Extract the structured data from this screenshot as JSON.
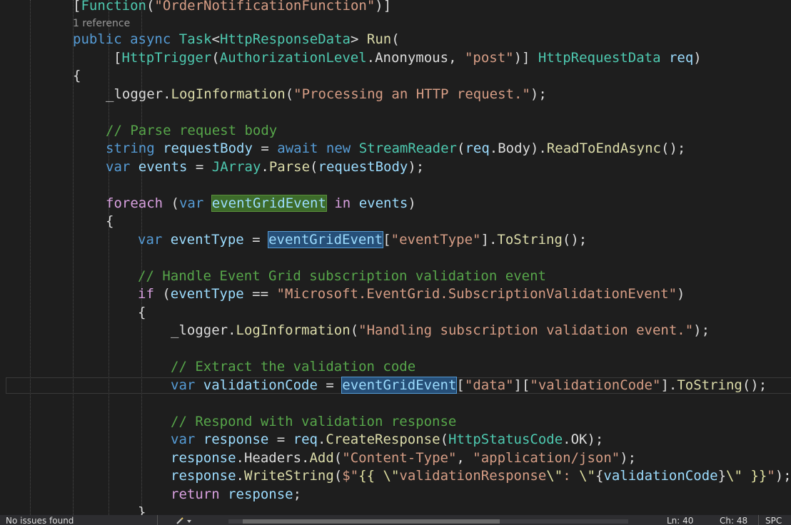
{
  "editor": {
    "codelens": "1 reference",
    "lines": [
      {
        "segments": [
          {
            "c": "fld",
            "t": "["
          },
          {
            "c": "ty",
            "t": "Function"
          },
          {
            "c": "fld",
            "t": "("
          },
          {
            "c": "str",
            "t": "\"OrderNotificationFunction\""
          },
          {
            "c": "fld",
            "t": ")]"
          }
        ]
      },
      {
        "segments": [
          {
            "c": "kw",
            "t": "public"
          },
          {
            "c": "fld",
            "t": " "
          },
          {
            "c": "kw",
            "t": "async"
          },
          {
            "c": "fld",
            "t": " "
          },
          {
            "c": "ty",
            "t": "Task"
          },
          {
            "c": "fld",
            "t": "<"
          },
          {
            "c": "ty",
            "t": "HttpResponseData"
          },
          {
            "c": "fld",
            "t": "> "
          },
          {
            "c": "mth",
            "t": "Run"
          },
          {
            "c": "fld",
            "t": "("
          }
        ]
      },
      {
        "segments": [
          {
            "c": "fld",
            "t": "["
          },
          {
            "c": "ty",
            "t": "HttpTrigger"
          },
          {
            "c": "fld",
            "t": "("
          },
          {
            "c": "ty",
            "t": "AuthorizationLevel"
          },
          {
            "c": "fld",
            "t": "."
          },
          {
            "c": "fld",
            "t": "Anonymous"
          },
          {
            "c": "fld",
            "t": ", "
          },
          {
            "c": "str",
            "t": "\"post\""
          },
          {
            "c": "fld",
            "t": ")] "
          },
          {
            "c": "ty",
            "t": "HttpRequestData"
          },
          {
            "c": "fld",
            "t": " "
          },
          {
            "c": "var",
            "t": "req"
          },
          {
            "c": "fld",
            "t": ")"
          }
        ]
      },
      {
        "segments": [
          {
            "c": "fld",
            "t": "{"
          }
        ]
      },
      {
        "segments": [
          {
            "c": "fld",
            "t": "_logger"
          },
          {
            "c": "fld",
            "t": "."
          },
          {
            "c": "mth",
            "t": "LogInformation"
          },
          {
            "c": "fld",
            "t": "("
          },
          {
            "c": "str",
            "t": "\"Processing an HTTP request.\""
          },
          {
            "c": "fld",
            "t": ");"
          }
        ]
      },
      {
        "segments": [
          {
            "c": "cm",
            "t": "// Parse request body"
          }
        ]
      },
      {
        "segments": [
          {
            "c": "kw",
            "t": "string"
          },
          {
            "c": "fld",
            "t": " "
          },
          {
            "c": "var",
            "t": "requestBody"
          },
          {
            "c": "fld",
            "t": " = "
          },
          {
            "c": "kw",
            "t": "await"
          },
          {
            "c": "fld",
            "t": " "
          },
          {
            "c": "kw",
            "t": "new"
          },
          {
            "c": "fld",
            "t": " "
          },
          {
            "c": "ty",
            "t": "StreamReader"
          },
          {
            "c": "fld",
            "t": "("
          },
          {
            "c": "var",
            "t": "req"
          },
          {
            "c": "fld",
            "t": ".Body)."
          },
          {
            "c": "mth",
            "t": "ReadToEndAsync"
          },
          {
            "c": "fld",
            "t": "();"
          }
        ]
      },
      {
        "segments": [
          {
            "c": "kw",
            "t": "var"
          },
          {
            "c": "fld",
            "t": " "
          },
          {
            "c": "var",
            "t": "events"
          },
          {
            "c": "fld",
            "t": " = "
          },
          {
            "c": "ty",
            "t": "JArray"
          },
          {
            "c": "fld",
            "t": "."
          },
          {
            "c": "mth",
            "t": "Parse"
          },
          {
            "c": "fld",
            "t": "("
          },
          {
            "c": "var",
            "t": "requestBody"
          },
          {
            "c": "fld",
            "t": ");"
          }
        ]
      },
      {
        "segments": [
          {
            "c": "ctl",
            "t": "foreach"
          },
          {
            "c": "fld",
            "t": " ("
          },
          {
            "c": "kw",
            "t": "var"
          },
          {
            "c": "fld",
            "t": " "
          },
          {
            "c": "hl-def",
            "t": "eventGridEvent"
          },
          {
            "c": "fld",
            "t": " "
          },
          {
            "c": "ctl",
            "t": "in"
          },
          {
            "c": "fld",
            "t": " "
          },
          {
            "c": "var",
            "t": "events"
          },
          {
            "c": "fld",
            "t": ")"
          }
        ]
      },
      {
        "segments": [
          {
            "c": "fld",
            "t": "{"
          }
        ]
      },
      {
        "segments": [
          {
            "c": "kw",
            "t": "var"
          },
          {
            "c": "fld",
            "t": " "
          },
          {
            "c": "var",
            "t": "eventType"
          },
          {
            "c": "fld",
            "t": " = "
          },
          {
            "c": "hl-ref",
            "t": "eventGridEvent"
          },
          {
            "c": "fld",
            "t": "["
          },
          {
            "c": "str",
            "t": "\"eventType\""
          },
          {
            "c": "fld",
            "t": "]."
          },
          {
            "c": "mth",
            "t": "ToString"
          },
          {
            "c": "fld",
            "t": "();"
          }
        ]
      },
      {
        "segments": [
          {
            "c": "cm",
            "t": "// Handle Event Grid subscription validation event"
          }
        ]
      },
      {
        "segments": [
          {
            "c": "ctl",
            "t": "if"
          },
          {
            "c": "fld",
            "t": " ("
          },
          {
            "c": "var",
            "t": "eventType"
          },
          {
            "c": "fld",
            "t": " == "
          },
          {
            "c": "str",
            "t": "\"Microsoft.EventGrid.SubscriptionValidationEvent\""
          },
          {
            "c": "fld",
            "t": ")"
          }
        ]
      },
      {
        "segments": [
          {
            "c": "fld",
            "t": "{"
          }
        ]
      },
      {
        "segments": [
          {
            "c": "fld",
            "t": "_logger"
          },
          {
            "c": "fld",
            "t": "."
          },
          {
            "c": "mth",
            "t": "LogInformation"
          },
          {
            "c": "fld",
            "t": "("
          },
          {
            "c": "str",
            "t": "\"Handling subscription validation event.\""
          },
          {
            "c": "fld",
            "t": ");"
          }
        ]
      },
      {
        "segments": [
          {
            "c": "cm",
            "t": "// Extract the validation code"
          }
        ]
      },
      {
        "segments": [
          {
            "c": "kw",
            "t": "var"
          },
          {
            "c": "fld",
            "t": " "
          },
          {
            "c": "var",
            "t": "validationCode"
          },
          {
            "c": "fld",
            "t": " = "
          },
          {
            "c": "hl-ref",
            "t": "eventGridEvent"
          },
          {
            "c": "fld",
            "t": "["
          },
          {
            "c": "str",
            "t": "\"data\""
          },
          {
            "c": "fld",
            "t": "]["
          },
          {
            "c": "str",
            "t": "\"validationCode\""
          },
          {
            "c": "fld",
            "t": "]."
          },
          {
            "c": "mth",
            "t": "ToString"
          },
          {
            "c": "fld",
            "t": "();"
          }
        ]
      },
      {
        "segments": [
          {
            "c": "cm",
            "t": "// Respond with validation response"
          }
        ]
      },
      {
        "segments": [
          {
            "c": "kw",
            "t": "var"
          },
          {
            "c": "fld",
            "t": " "
          },
          {
            "c": "var",
            "t": "response"
          },
          {
            "c": "fld",
            "t": " = "
          },
          {
            "c": "var",
            "t": "req"
          },
          {
            "c": "fld",
            "t": "."
          },
          {
            "c": "mth",
            "t": "CreateResponse"
          },
          {
            "c": "fld",
            "t": "("
          },
          {
            "c": "ty",
            "t": "HttpStatusCode"
          },
          {
            "c": "fld",
            "t": ".OK);"
          }
        ]
      },
      {
        "segments": [
          {
            "c": "var",
            "t": "response"
          },
          {
            "c": "fld",
            "t": ".Headers."
          },
          {
            "c": "mth",
            "t": "Add"
          },
          {
            "c": "fld",
            "t": "("
          },
          {
            "c": "str",
            "t": "\"Content-Type\""
          },
          {
            "c": "fld",
            "t": ", "
          },
          {
            "c": "str",
            "t": "\"application/json\""
          },
          {
            "c": "fld",
            "t": ");"
          }
        ]
      },
      {
        "segments": [
          {
            "c": "var",
            "t": "response"
          },
          {
            "c": "fld",
            "t": "."
          },
          {
            "c": "mth",
            "t": "WriteString"
          },
          {
            "c": "fld",
            "t": "("
          },
          {
            "c": "str",
            "t": "$\""
          },
          {
            "c": "esc",
            "t": "{{"
          },
          {
            "c": "str",
            "t": " "
          },
          {
            "c": "esc",
            "t": "\\\""
          },
          {
            "c": "str",
            "t": "validationResponse"
          },
          {
            "c": "esc",
            "t": "\\\""
          },
          {
            "c": "str",
            "t": ": "
          },
          {
            "c": "esc",
            "t": "\\\""
          },
          {
            "c": "fld",
            "t": "{"
          },
          {
            "c": "var",
            "t": "validationCode"
          },
          {
            "c": "fld",
            "t": "}"
          },
          {
            "c": "esc",
            "t": "\\\""
          },
          {
            "c": "str",
            "t": " "
          },
          {
            "c": "esc",
            "t": "}}"
          },
          {
            "c": "str",
            "t": "\""
          },
          {
            "c": "fld",
            "t": ");"
          }
        ]
      },
      {
        "segments": [
          {
            "c": "ctl",
            "t": "return"
          },
          {
            "c": "fld",
            "t": " "
          },
          {
            "c": "var",
            "t": "response"
          },
          {
            "c": "fld",
            "t": ";"
          }
        ]
      },
      {
        "segments": [
          {
            "c": "fld",
            "t": "}"
          }
        ]
      }
    ]
  },
  "status": {
    "issues": "No issues found",
    "position_line": "Ln: 40",
    "position_char": "Ch: 48",
    "encoding": "SPC"
  },
  "colors": {
    "background": "#1e1e1e",
    "keyword": "#569cd6",
    "type": "#4ec9b0",
    "string": "#d69d85",
    "comment": "#57a64a",
    "method": "#dcdcaa",
    "variable": "#9cdcfe",
    "highlight_definition": "#3d6b2a",
    "highlight_reference": "#264f78"
  }
}
